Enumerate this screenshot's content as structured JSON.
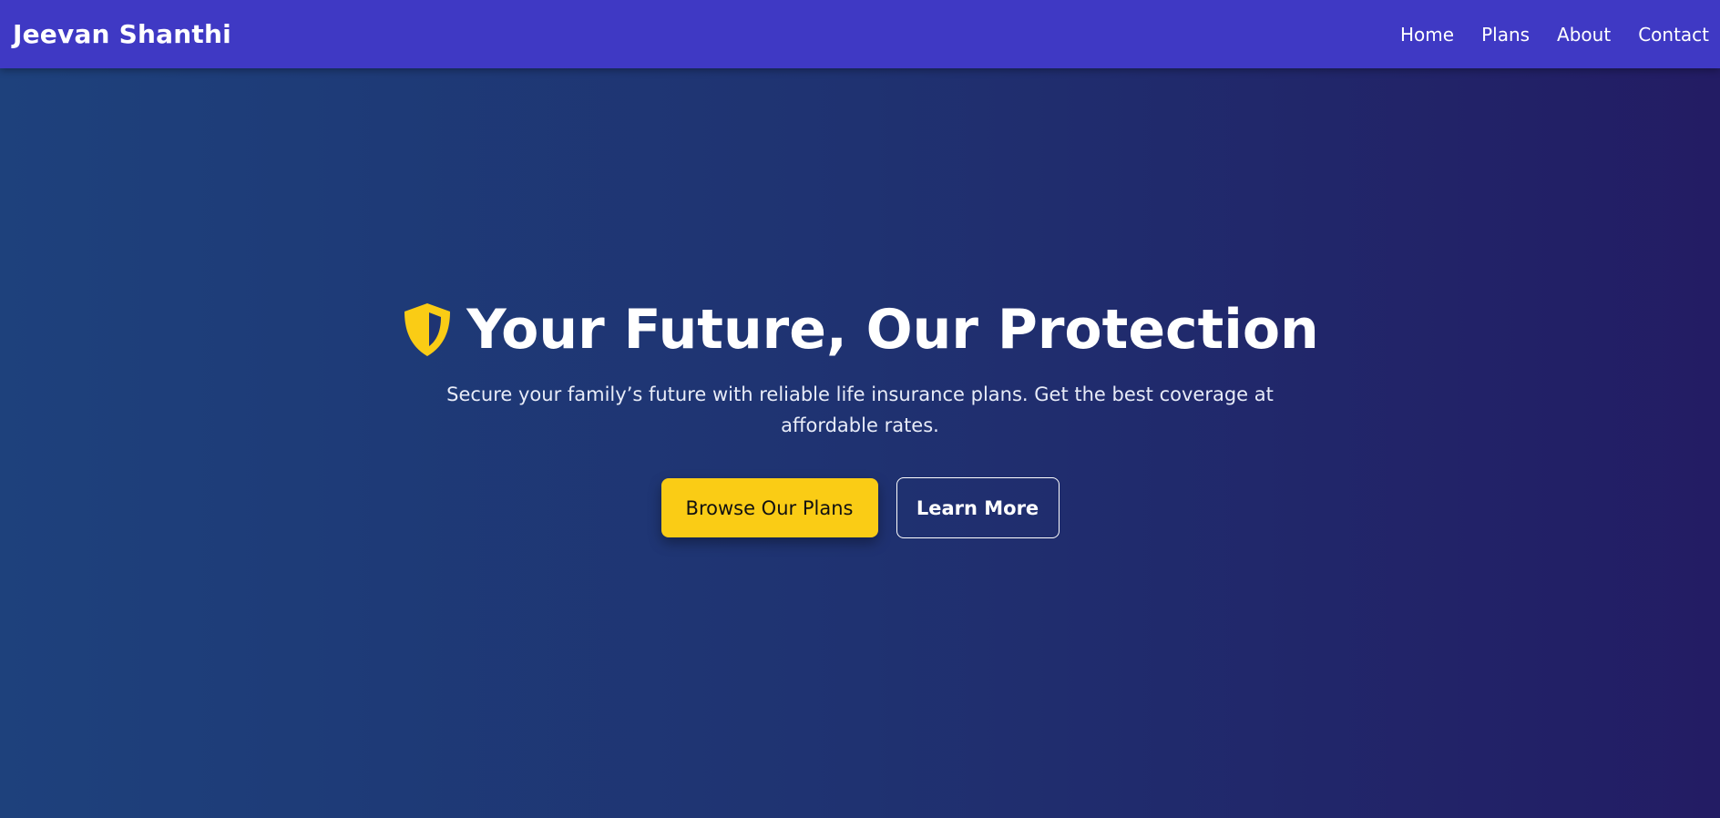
{
  "header": {
    "brand": "Jeevan Shanthi",
    "nav": [
      {
        "label": "Home"
      },
      {
        "label": "Plans"
      },
      {
        "label": "About"
      },
      {
        "label": "Contact"
      }
    ]
  },
  "hero": {
    "icon": "shield-icon",
    "title": "Your Future, Our Protection",
    "subtitle": "Secure your family’s future with reliable life insurance plans. Get the best coverage at affordable rates.",
    "primary_button": "Browse Our Plans",
    "secondary_button": "Learn More"
  },
  "colors": {
    "navbar": "#3f39c4",
    "background_start": "#1e417c",
    "background_end": "#231c64",
    "accent": "#facc15",
    "text": "#ffffff"
  }
}
